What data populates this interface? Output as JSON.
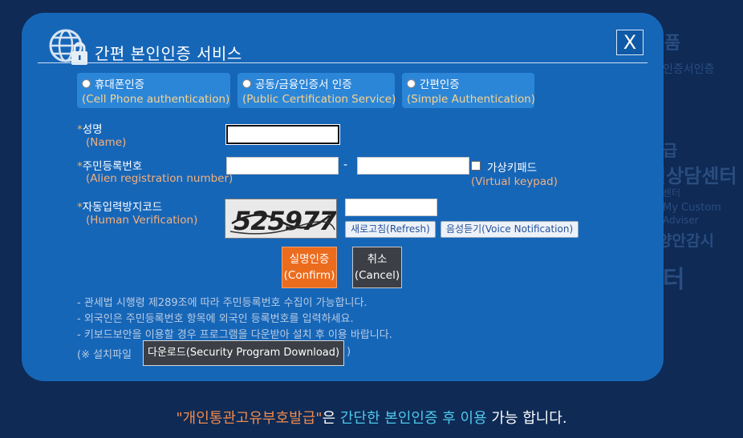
{
  "background": {
    "texts": [
      "품",
      "인증서인증",
      "급",
      "원상담센터",
      "센터",
      "My Custom",
      "Adviser",
      "양안감시",
      "터"
    ]
  },
  "dialog": {
    "title": "간편 본인인증 서비스",
    "close_label": "X",
    "header_icon": "globe-lock-icon",
    "auth_options": [
      {
        "label": "휴대폰인증",
        "sub": "(Cell Phone authentication)"
      },
      {
        "label": "공동/금융인증서 인증",
        "sub": "(Public Certification Service)"
      },
      {
        "label": "간편인증",
        "sub": "(Simple Authentication)"
      }
    ],
    "fields": {
      "name": {
        "star": "*",
        "label": "성명",
        "sub": "(Name)",
        "value": ""
      },
      "reg": {
        "star": "*",
        "label": "주민등록번호",
        "sub": "(Alien registration number)",
        "dash": "-",
        "value1": "",
        "value2": ""
      },
      "virtual_keypad": {
        "label": "가상키패드",
        "sub": "(Virtual keypad)"
      },
      "captcha": {
        "star": "*",
        "label": "자동입력방지코드",
        "sub": "(Human Verification)",
        "code": "525977",
        "value": ""
      }
    },
    "buttons": {
      "refresh": "새로고침(Refresh)",
      "voice": "음성듣기(Voice Notification)",
      "confirm_main": "실명인증",
      "confirm_sub": "(Confirm)",
      "cancel_main": "취소",
      "cancel_sub": "(Cancel)"
    },
    "notes": [
      "- 관세법 시행령 제289조에 따라 주민등록번호 수집이 가능합니다.",
      "- 외국인은 주민등록번호 항목에 외국인 등록번호를 입력하세요.",
      "- 키보드보안을 이용할 경우 프로그램을 다운받아 설치 후 이용 바랍니다."
    ],
    "install_prefix": "(※ 설치파일",
    "download_label": "다운로드(Security Program Download)",
    "install_suffix": ")"
  },
  "footer": {
    "part1": "\"개인통관고유부호발급\"",
    "part2": "은 ",
    "part3": "간단한 본인인증 후 이용",
    "part4": " 가능 합니다."
  },
  "colors": {
    "dialog_bg": "#1666b8",
    "option_bg": "#2c86d8",
    "sub_label": "#f3b07a",
    "confirm": "#ec6c1e",
    "cancel": "#3c3f45",
    "footer_orange": "#f08a4b",
    "footer_cyan": "#4fc8ec"
  }
}
